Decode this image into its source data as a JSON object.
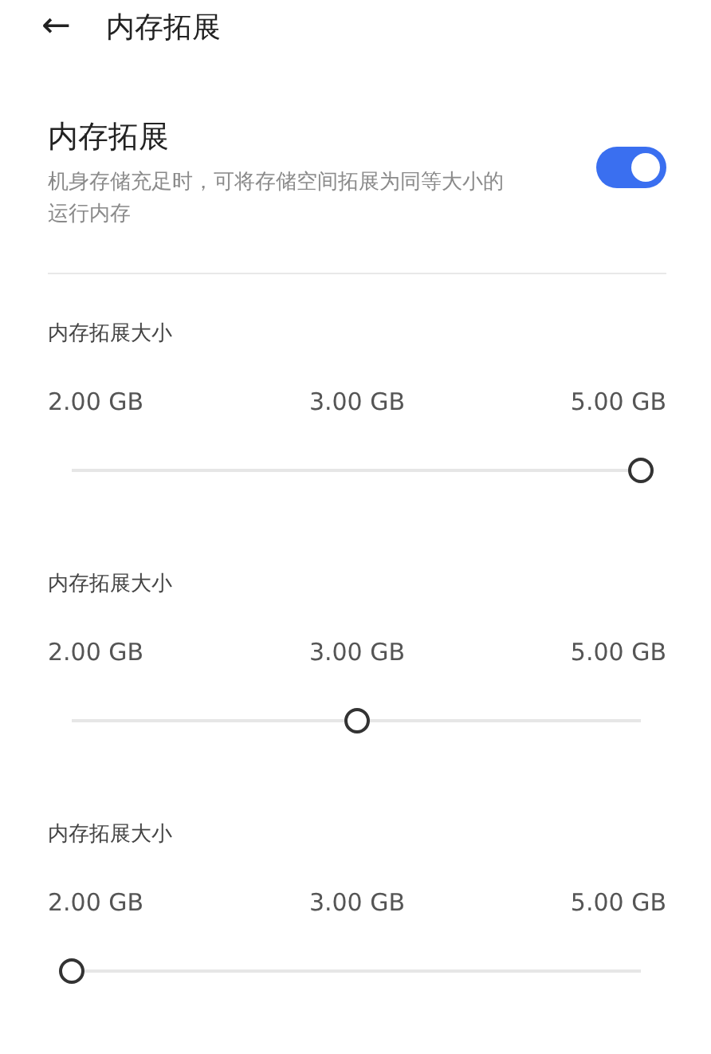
{
  "header": {
    "back_icon": "←",
    "title": "内存拓展"
  },
  "setting": {
    "title": "内存拓展",
    "description": "机身存储充足时，可将存储空间拓展为同等大小的运行内存",
    "on": true
  },
  "sliders": [
    {
      "label": "内存拓展大小",
      "ticks": [
        "2.00 GB",
        "3.00 GB",
        "5.00 GB"
      ],
      "level": 1
    },
    {
      "label": "内存拓展大小",
      "ticks": [
        "2.00 GB",
        "3.00 GB",
        "5.00 GB"
      ],
      "level": 0.5
    },
    {
      "label": "内存拓展大小",
      "ticks": [
        "2.00 GB",
        "3.00 GB",
        "5.00 GB"
      ],
      "level": 0
    }
  ]
}
